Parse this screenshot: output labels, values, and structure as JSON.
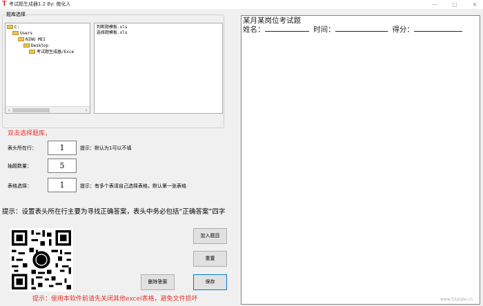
{
  "window": {
    "title": "考试题生成器1.2    By:   傲化人",
    "min": "—",
    "max": "□",
    "close": "×"
  },
  "group": {
    "label": "题库选择"
  },
  "tree": {
    "nodes": [
      "C:",
      "Users",
      "NING MEI",
      "Desktop",
      "考试题生成器/Exce"
    ],
    "scroll_left": "‹",
    "scroll_right": "›"
  },
  "files": [
    "判断题模板.xls",
    "选择题模板.xls"
  ],
  "double_click_hint": "双击选择题库，",
  "form": {
    "header_row": {
      "label": "表头所在行：",
      "value": "1",
      "hint": "提示：默认为1可以不填"
    },
    "count": {
      "label": "抽题数量：",
      "value": "5"
    },
    "sheet": {
      "label": "表格选择：",
      "value": "1",
      "hint": "提示：有多个表请自己选择表格，默认第一张表格"
    }
  },
  "tip_header": "提示：设置表头所在行主要为寻找正确答案，表头中务必包括“正确答案”四字",
  "buttons": {
    "add": "加入题目",
    "reset": "重置",
    "delete_answer": "删除答案",
    "save": "保存"
  },
  "bottom_tip": "提示：使用本软件前请先关闭其他excel表格，避免文件损坏",
  "paper": {
    "title": "某月某岗位考试题",
    "name_label": "姓名：",
    "time_label": "时间：",
    "score_label": "得分："
  },
  "watermark": "www.52pojie.cn"
}
